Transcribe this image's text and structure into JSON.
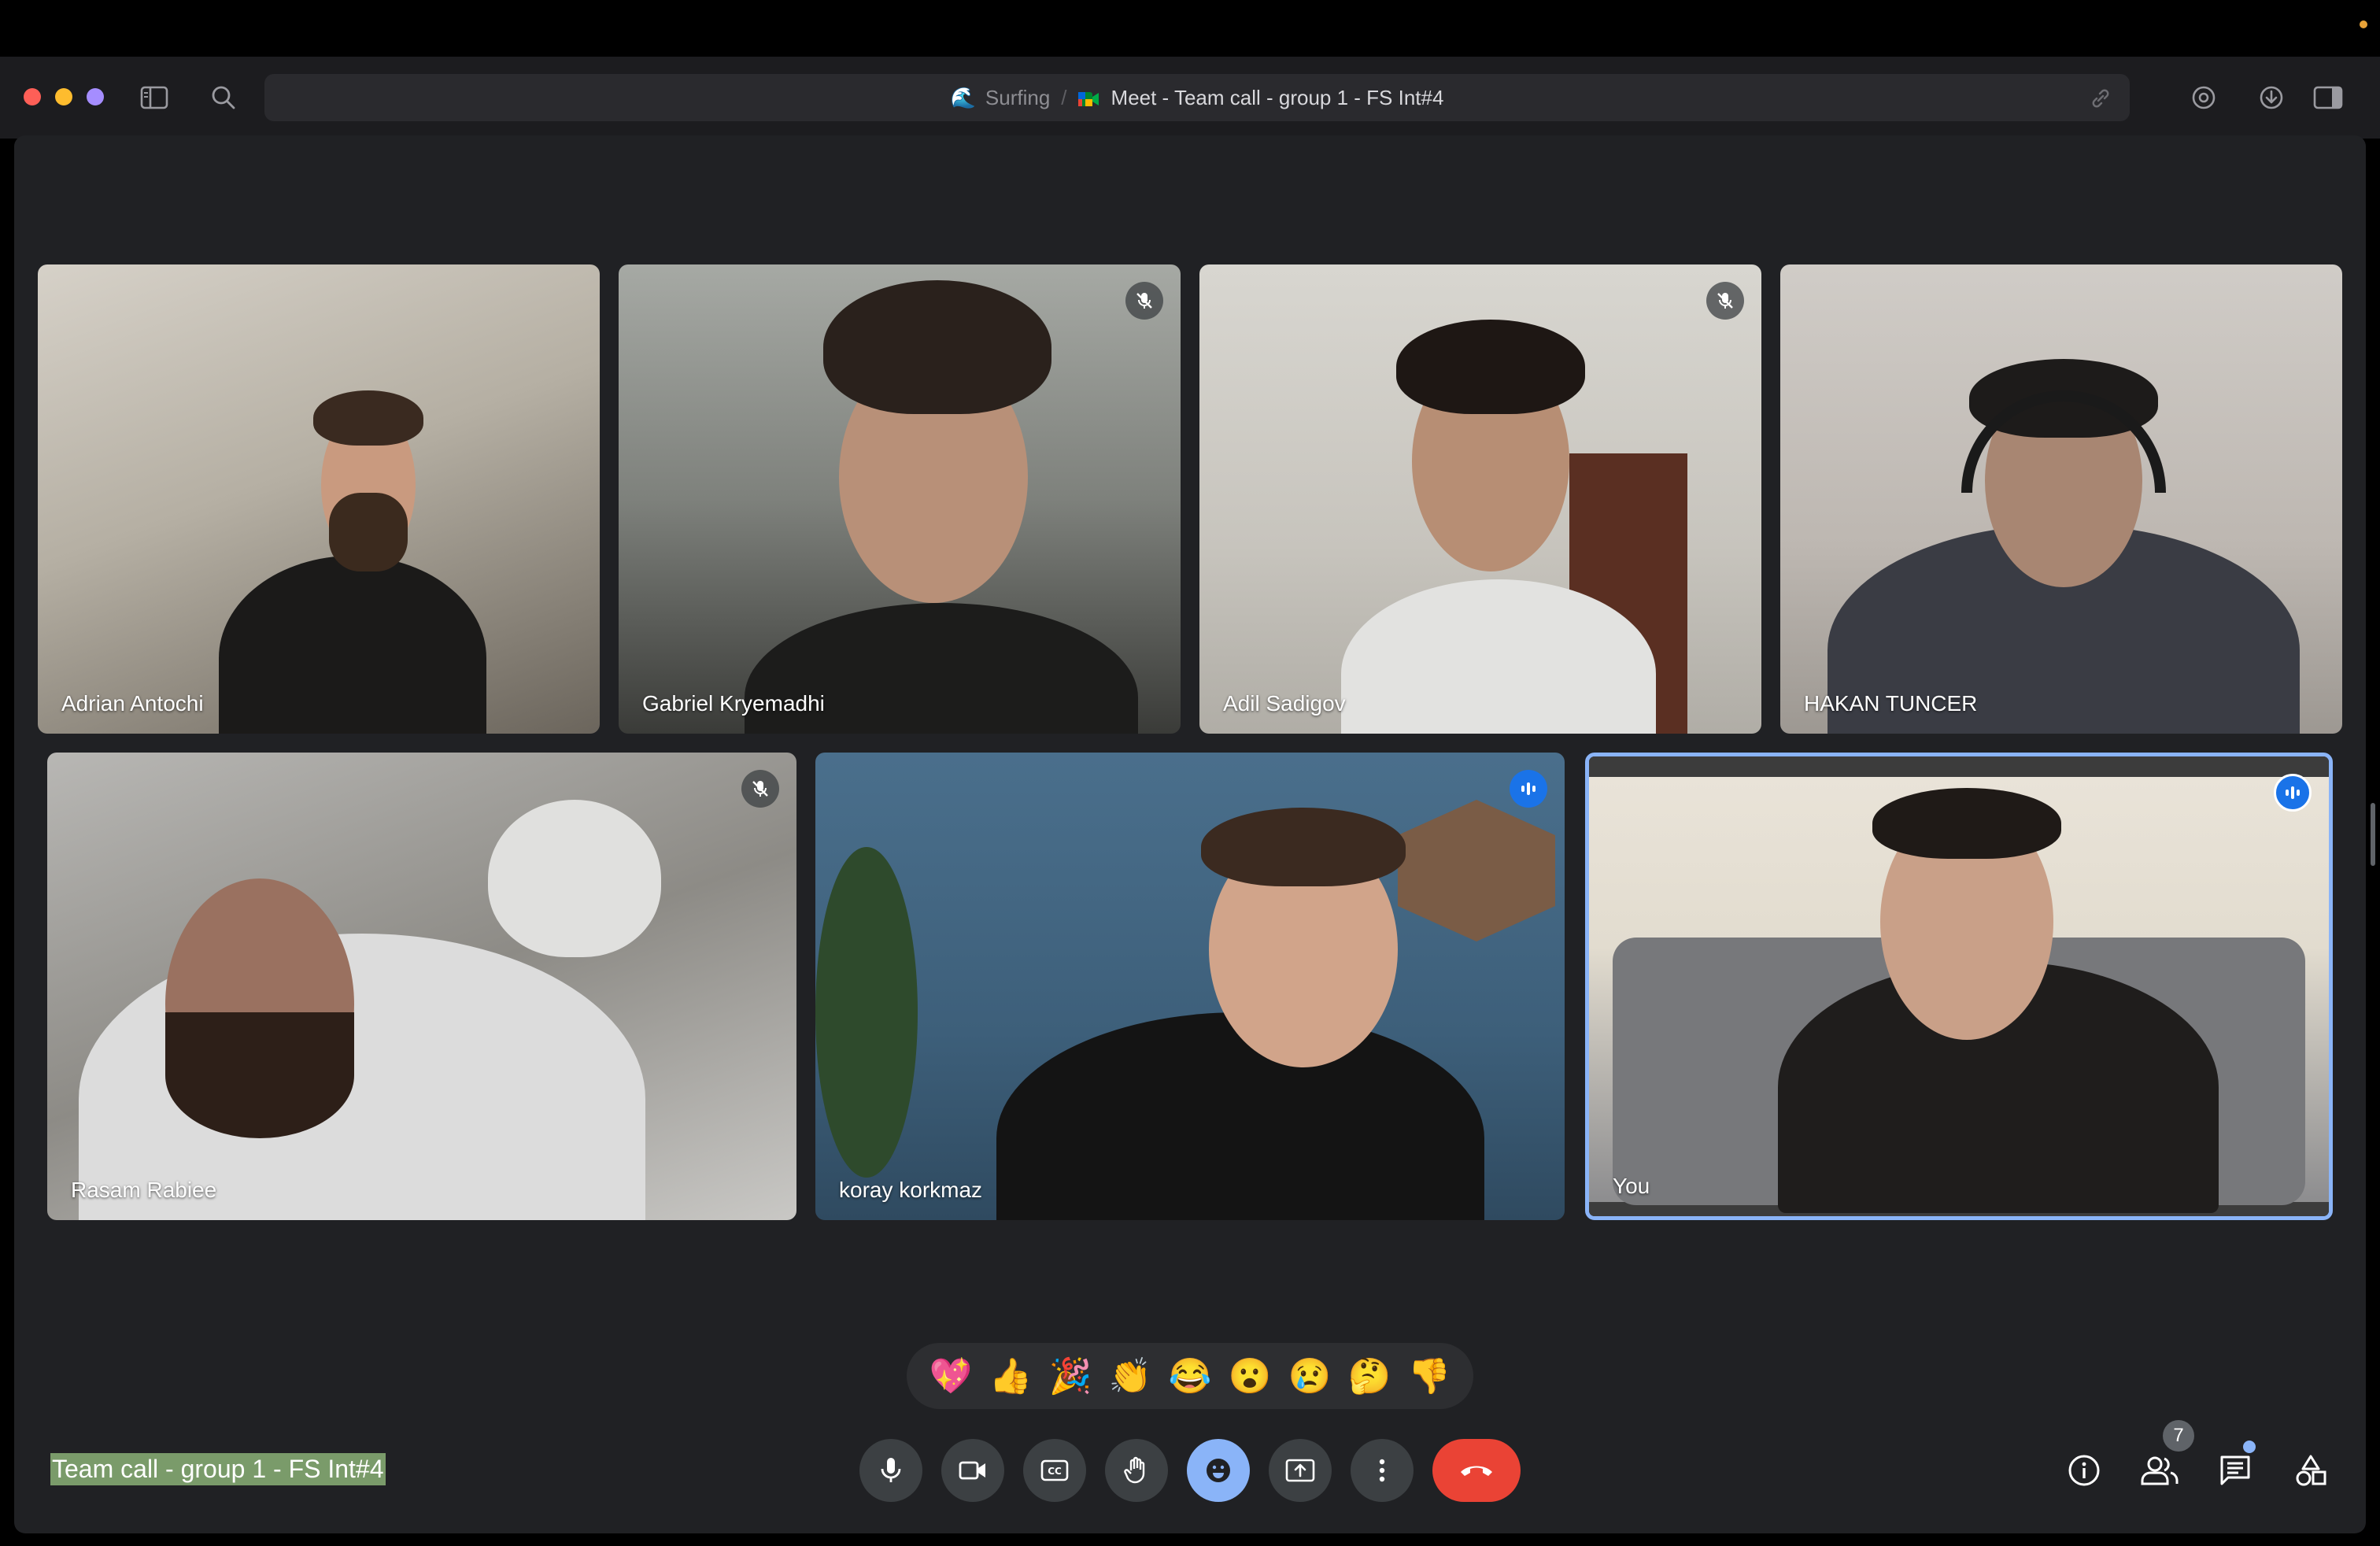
{
  "browser": {
    "space_emoji": "🌊",
    "space_label": "Surfing",
    "separator": "/",
    "tab_title": "Meet - Team call - group 1 - FS Int#4"
  },
  "participants": [
    {
      "name": "Adrian Antochi",
      "muted": false,
      "speaking": false
    },
    {
      "name": "Gabriel Kryemadhi",
      "muted": true,
      "speaking": false
    },
    {
      "name": "Adil Sadigov",
      "muted": true,
      "speaking": false
    },
    {
      "name": "HAKAN TUNCER",
      "muted": false,
      "speaking": false
    },
    {
      "name": "Rasam Rabiee",
      "muted": true,
      "speaking": false
    },
    {
      "name": "koray korkmaz",
      "muted": false,
      "speaking": true
    },
    {
      "name": "You",
      "muted": false,
      "speaking": true
    }
  ],
  "reactions": [
    "💖",
    "👍",
    "🎉",
    "👏",
    "😂",
    "😮",
    "😢",
    "🤔",
    "👎"
  ],
  "meeting": {
    "title": "Team call - group 1 - FS Int#4",
    "participant_count": "7"
  },
  "colors": {
    "stage_bg": "#202124",
    "hangup": "#ea4335",
    "active_ctrl": "#8ab4f8",
    "speaking_border": "#8ab4f8",
    "speaking_badge": "#1a73e8"
  }
}
